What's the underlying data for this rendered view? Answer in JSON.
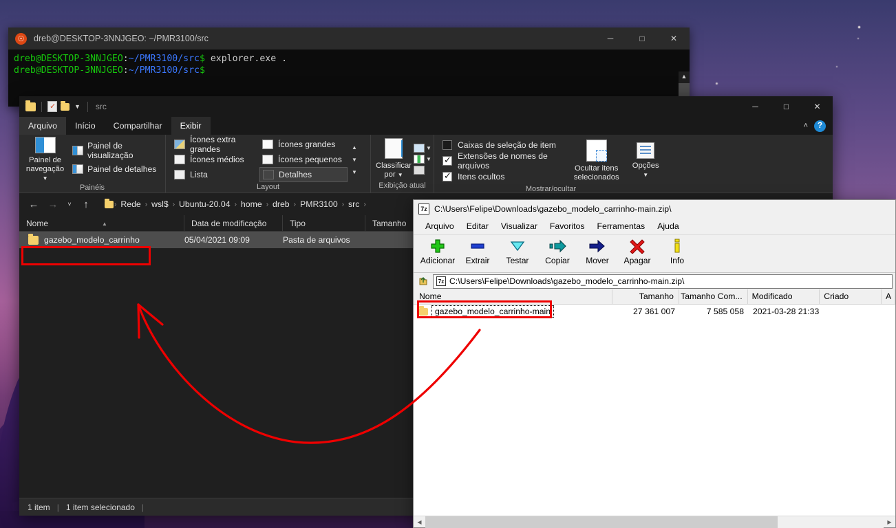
{
  "terminal": {
    "title": "dreb@DESKTOP-3NNJGEO: ~/PMR3100/src",
    "prompt_user": "dreb@DESKTOP-3NNJGEO",
    "prompt_sep": ":",
    "prompt_path": "~/PMR3100/src",
    "prompt_dollar": "$",
    "command": " explorer.exe .",
    "controls": {
      "minimize": "─",
      "maximize": "□",
      "close": "✕"
    }
  },
  "explorer": {
    "quick_access_title": "src",
    "controls": {
      "minimize": "─",
      "maximize": "□",
      "close": "✕"
    },
    "tabs": [
      {
        "label": "Arquivo"
      },
      {
        "label": "Início"
      },
      {
        "label": "Compartilhar"
      },
      {
        "label": "Exibir"
      }
    ],
    "ribbon": {
      "groups": [
        {
          "label": "Painéis"
        },
        {
          "label": "Layout"
        },
        {
          "label": "Exibição atual"
        },
        {
          "label": "Mostrar/ocultar"
        }
      ],
      "nav_pane": "Painel de\nnavegação",
      "nav_pane_line1": "Painel de",
      "nav_pane_line2": "navegação",
      "preview_pane": "Painel de visualização",
      "details_pane": "Painel de detalhes",
      "layout_items": [
        "Ícones extra grandes",
        "Ícones grandes",
        "Ícones médios",
        "Ícones pequenos",
        "Lista",
        "Detalhes"
      ],
      "layout_selected": "Detalhes",
      "sort_by_line1": "Classificar",
      "sort_by_line2": "por",
      "checkboxes": [
        {
          "label": "Caixas de seleção de item",
          "checked": false
        },
        {
          "label": "Extensões de nomes de arquivos",
          "checked": true
        },
        {
          "label": "Itens ocultos",
          "checked": true
        }
      ],
      "hide_selected_line1": "Ocultar itens",
      "hide_selected_line2": "selecionados",
      "options": "Opções",
      "help_glyph": "?",
      "collapse_glyph": "˄"
    },
    "address": {
      "back": "←",
      "forward": "→",
      "recent": "˅",
      "up": "↑",
      "breadcrumbs": [
        "Rede",
        "wsl$",
        "Ubuntu-20.04",
        "home",
        "dreb",
        "PMR3100",
        "src"
      ],
      "separator": "›"
    },
    "columns": [
      {
        "label": "Nome",
        "sorted": true
      },
      {
        "label": "Data de modificação"
      },
      {
        "label": "Tipo"
      },
      {
        "label": "Tamanho"
      }
    ],
    "rows": [
      {
        "name": "gazebo_modelo_carrinho",
        "modified": "05/04/2021 09:09",
        "type": "Pasta de arquivos",
        "size": ""
      }
    ],
    "status": {
      "count": "1 item",
      "selected": "1 item selecionado"
    }
  },
  "sevenzip": {
    "title": "C:\\Users\\Felipe\\Downloads\\gazebo_modelo_carrinho-main.zip\\",
    "app_icon_text": "7z",
    "menu": [
      "Arquivo",
      "Editar",
      "Visualizar",
      "Favoritos",
      "Ferramentas",
      "Ajuda"
    ],
    "toolbar": [
      {
        "label": "Adicionar",
        "icon": "plus-icon"
      },
      {
        "label": "Extrair",
        "icon": "extract-icon"
      },
      {
        "label": "Testar",
        "icon": "test-icon"
      },
      {
        "label": "Copiar",
        "icon": "copy-icon"
      },
      {
        "label": "Mover",
        "icon": "move-icon"
      },
      {
        "label": "Apagar",
        "icon": "delete-icon"
      },
      {
        "label": "Info",
        "icon": "info-icon"
      }
    ],
    "path_value": "C:\\Users\\Felipe\\Downloads\\gazebo_modelo_carrinho-main.zip\\",
    "columns": [
      "Nome",
      "Tamanho",
      "Tamanho Com...",
      "Modificado",
      "Criado",
      "A"
    ],
    "rows": [
      {
        "name": "gazebo_modelo_carrinho-main",
        "size": "27 361 007",
        "packed": "7 585 058",
        "modified": "2021-03-28 21:33",
        "created": "",
        "attr": ""
      }
    ]
  },
  "annotations": {
    "highlight_color": "#ee0000",
    "arrow_description": "curved-red-arrow-pointing-to-explorer-folder"
  }
}
